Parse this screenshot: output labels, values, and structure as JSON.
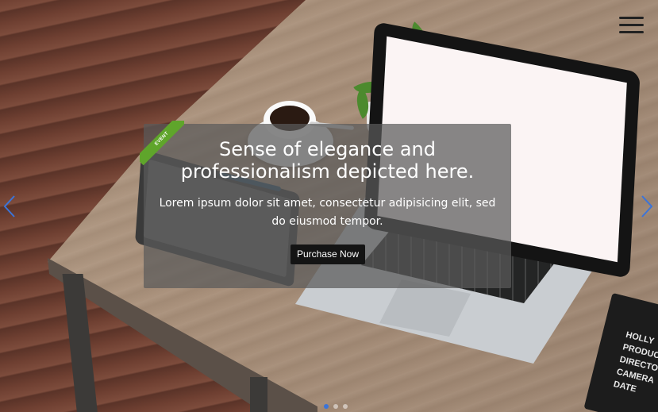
{
  "hero": {
    "caption": {
      "badge": "EVENT",
      "title_line1": "Sense of elegance and",
      "title_line2": "professionalism depicted here.",
      "body_line1": "Lorem ipsum dolor sit amet, consectetur adipisicing elit, sed",
      "body_line2": "do eiusmod tempor.",
      "button_label": "Purchase Now"
    },
    "clapperboard_text": [
      "HOLLY",
      "PRODUCT",
      "DIRECTO",
      "CAMERA",
      "DATE"
    ],
    "slide_count": 3,
    "active_slide": 1
  },
  "nav": {
    "menu_icon": "hamburger-icon",
    "prev_icon": "chevron-left-icon",
    "next_icon": "chevron-right-icon"
  },
  "colors": {
    "arrow": "#3b74d9",
    "badge": "#5fa52b",
    "button": "#141414",
    "active_dot": "#3b74d9"
  }
}
